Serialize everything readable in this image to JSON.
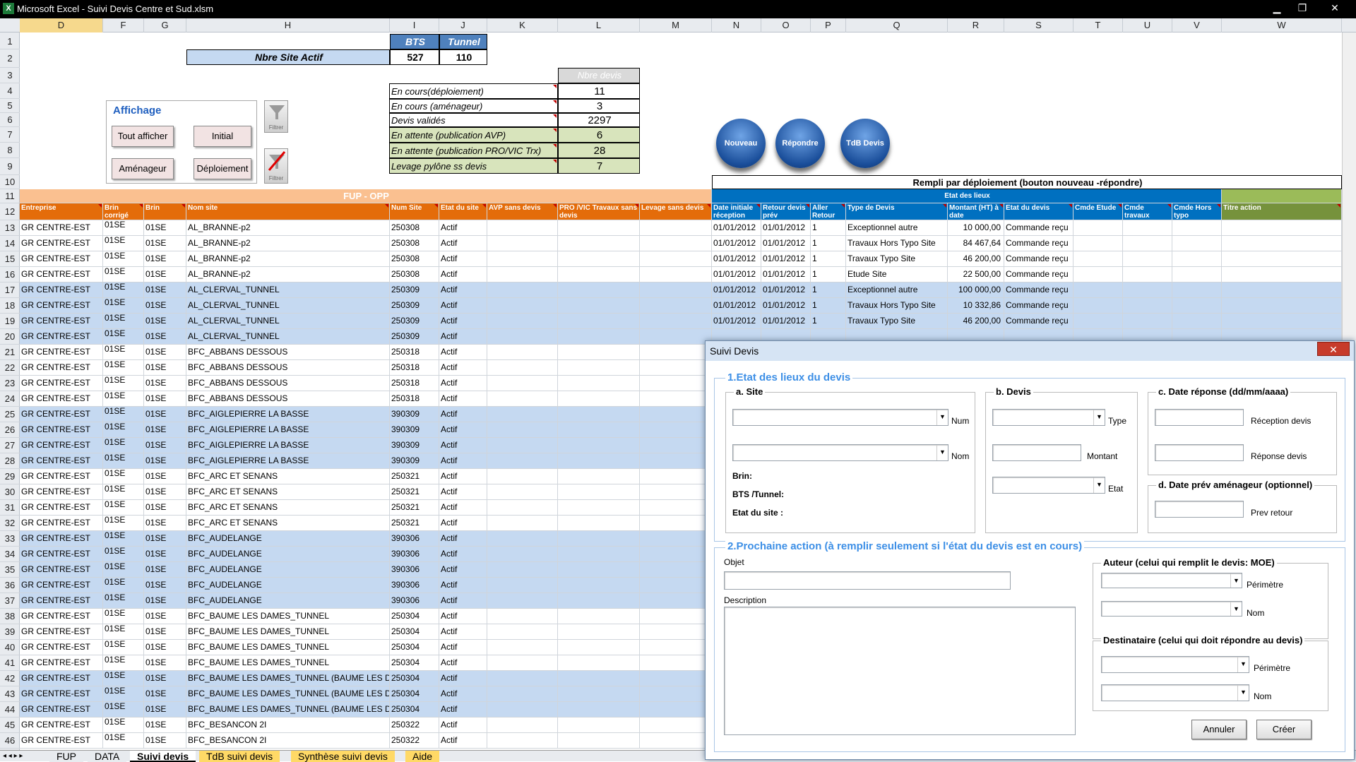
{
  "window": {
    "title": "Microsoft Excel - Suivi Devis Centre et Sud.xlsm",
    "app_icon": "X",
    "minimize": "▁",
    "restore": "❐",
    "close": "✕"
  },
  "columns": [
    "D",
    "F",
    "G",
    "H",
    "I",
    "J",
    "K",
    "L",
    "M",
    "N",
    "O",
    "P",
    "Q",
    "R",
    "S",
    "T",
    "U",
    "V",
    "W"
  ],
  "rows": [
    "1",
    "2",
    "3",
    "4",
    "5",
    "6",
    "7",
    "8",
    "9",
    "10",
    "11",
    "12",
    "13",
    "14",
    "15",
    "16",
    "17",
    "18",
    "19",
    "20",
    "21",
    "22",
    "23",
    "24",
    "25",
    "26",
    "27",
    "28",
    "29",
    "30",
    "31",
    "32",
    "33",
    "34",
    "35",
    "36",
    "37",
    "38",
    "39",
    "40",
    "41",
    "42",
    "43",
    "44",
    "45",
    "46"
  ],
  "top": {
    "bts": "BTS",
    "tunnel": "Tunnel",
    "nbre_site_actif": "Nbre Site Actif",
    "bts_val": "527",
    "tunnel_val": "110",
    "nbre_devis": "Nbre devis",
    "stats": [
      {
        "label": "En cours(déploiement)",
        "value": "11"
      },
      {
        "label": "En cours (aménageur)",
        "value": "3"
      },
      {
        "label": "Devis validés",
        "value": "2297"
      },
      {
        "label": "En attente (publication AVP)",
        "value": "6"
      },
      {
        "label": "En attente (publication PRO/VIC Trx)",
        "value": "28"
      },
      {
        "label": "Levage pylône ss devis",
        "value": "7"
      }
    ],
    "affichage": "Affichage",
    "tout_afficher": "Tout afficher",
    "initial": "Initial",
    "amenageur": "Aménageur",
    "deploiement": "Déploiement",
    "filtrer": "Filtrer",
    "filtrer2": "Filtrer",
    "nouveau": "Nouveau",
    "repondre": "Répondre",
    "tdb": "TdB Devis",
    "rempli": "Rempli par déploiement (bouton nouveau -répondre)",
    "fup": "FUP - OPP",
    "etat_lieux": "Etat des lieux"
  },
  "headers": [
    "Entreprise",
    "Brin corrigé",
    "Brin",
    "Nom site",
    "Num Site",
    "Etat du site",
    "AVP sans devis",
    "PRO /VIC Travaux sans devis",
    "Levage sans devis",
    "Date initiale réception",
    "Retour devis prév",
    "Aller Retour",
    "Type de Devis",
    "Montant (HT) à date",
    "Etat du devis",
    "Cmde Etude",
    "Cmde travaux",
    "Cmde Hors typo",
    "Titre action"
  ],
  "data_rows": [
    {
      "e": "GR CENTRE-EST",
      "bc": "01SE",
      "b": "01SE",
      "n": "AL_BRANNE-p2",
      "num": "250308",
      "et": "Actif",
      "d1": "01/01/2012",
      "d2": "01/01/2012",
      "ar": "1",
      "t": "Exceptionnel autre",
      "m": "10 000,00",
      "ed": "Commande reçu",
      "blue": false
    },
    {
      "e": "GR CENTRE-EST",
      "bc": "01SE",
      "b": "01SE",
      "n": "AL_BRANNE-p2",
      "num": "250308",
      "et": "Actif",
      "d1": "01/01/2012",
      "d2": "01/01/2012",
      "ar": "1",
      "t": "Travaux Hors Typo Site",
      "m": "84 467,64",
      "ed": "Commande reçu",
      "blue": false
    },
    {
      "e": "GR CENTRE-EST",
      "bc": "01SE",
      "b": "01SE",
      "n": "AL_BRANNE-p2",
      "num": "250308",
      "et": "Actif",
      "d1": "01/01/2012",
      "d2": "01/01/2012",
      "ar": "1",
      "t": "Travaux Typo Site",
      "m": "46 200,00",
      "ed": "Commande reçu",
      "blue": false
    },
    {
      "e": "GR CENTRE-EST",
      "bc": "01SE",
      "b": "01SE",
      "n": "AL_BRANNE-p2",
      "num": "250308",
      "et": "Actif",
      "d1": "01/01/2012",
      "d2": "01/01/2012",
      "ar": "1",
      "t": "Etude Site",
      "m": "22 500,00",
      "ed": "Commande reçu",
      "blue": false
    },
    {
      "e": "GR CENTRE-EST",
      "bc": "01SE",
      "b": "01SE",
      "n": "AL_CLERVAL_TUNNEL",
      "num": "250309",
      "et": "Actif",
      "d1": "01/01/2012",
      "d2": "01/01/2012",
      "ar": "1",
      "t": "Exceptionnel autre",
      "m": "100 000,00",
      "ed": "Commande reçu",
      "blue": true
    },
    {
      "e": "GR CENTRE-EST",
      "bc": "01SE",
      "b": "01SE",
      "n": "AL_CLERVAL_TUNNEL",
      "num": "250309",
      "et": "Actif",
      "d1": "01/01/2012",
      "d2": "01/01/2012",
      "ar": "1",
      "t": "Travaux Hors Typo Site",
      "m": "10 332,86",
      "ed": "Commande reçu",
      "blue": true
    },
    {
      "e": "GR CENTRE-EST",
      "bc": "01SE",
      "b": "01SE",
      "n": "AL_CLERVAL_TUNNEL",
      "num": "250309",
      "et": "Actif",
      "d1": "01/01/2012",
      "d2": "01/01/2012",
      "ar": "1",
      "t": "Travaux Typo Site",
      "m": "46 200,00",
      "ed": "Commande reçu",
      "blue": true
    },
    {
      "e": "GR CENTRE-EST",
      "bc": "01SE",
      "b": "01SE",
      "n": "AL_CLERVAL_TUNNEL",
      "num": "250309",
      "et": "Actif",
      "d1": "",
      "d2": "",
      "ar": "",
      "t": "",
      "m": "",
      "ed": "",
      "blue": true
    },
    {
      "e": "GR CENTRE-EST",
      "bc": "01SE",
      "b": "01SE",
      "n": "BFC_ABBANS DESSOUS",
      "num": "250318",
      "et": "Actif",
      "blue": false
    },
    {
      "e": "GR CENTRE-EST",
      "bc": "01SE",
      "b": "01SE",
      "n": "BFC_ABBANS DESSOUS",
      "num": "250318",
      "et": "Actif",
      "blue": false
    },
    {
      "e": "GR CENTRE-EST",
      "bc": "01SE",
      "b": "01SE",
      "n": "BFC_ABBANS DESSOUS",
      "num": "250318",
      "et": "Actif",
      "blue": false
    },
    {
      "e": "GR CENTRE-EST",
      "bc": "01SE",
      "b": "01SE",
      "n": "BFC_ABBANS DESSOUS",
      "num": "250318",
      "et": "Actif",
      "blue": false
    },
    {
      "e": "GR CENTRE-EST",
      "bc": "01SE",
      "b": "01SE",
      "n": "BFC_AIGLEPIERRE LA BASSE",
      "num": "390309",
      "et": "Actif",
      "blue": true
    },
    {
      "e": "GR CENTRE-EST",
      "bc": "01SE",
      "b": "01SE",
      "n": "BFC_AIGLEPIERRE LA BASSE",
      "num": "390309",
      "et": "Actif",
      "blue": true
    },
    {
      "e": "GR CENTRE-EST",
      "bc": "01SE",
      "b": "01SE",
      "n": "BFC_AIGLEPIERRE LA BASSE",
      "num": "390309",
      "et": "Actif",
      "blue": true
    },
    {
      "e": "GR CENTRE-EST",
      "bc": "01SE",
      "b": "01SE",
      "n": "BFC_AIGLEPIERRE LA BASSE",
      "num": "390309",
      "et": "Actif",
      "blue": true
    },
    {
      "e": "GR CENTRE-EST",
      "bc": "01SE",
      "b": "01SE",
      "n": "BFC_ARC ET SENANS",
      "num": "250321",
      "et": "Actif",
      "blue": false
    },
    {
      "e": "GR CENTRE-EST",
      "bc": "01SE",
      "b": "01SE",
      "n": "BFC_ARC ET SENANS",
      "num": "250321",
      "et": "Actif",
      "blue": false
    },
    {
      "e": "GR CENTRE-EST",
      "bc": "01SE",
      "b": "01SE",
      "n": "BFC_ARC ET SENANS",
      "num": "250321",
      "et": "Actif",
      "blue": false
    },
    {
      "e": "GR CENTRE-EST",
      "bc": "01SE",
      "b": "01SE",
      "n": "BFC_ARC ET SENANS",
      "num": "250321",
      "et": "Actif",
      "blue": false
    },
    {
      "e": "GR CENTRE-EST",
      "bc": "01SE",
      "b": "01SE",
      "n": "BFC_AUDELANGE",
      "num": "390306",
      "et": "Actif",
      "blue": true
    },
    {
      "e": "GR CENTRE-EST",
      "bc": "01SE",
      "b": "01SE",
      "n": "BFC_AUDELANGE",
      "num": "390306",
      "et": "Actif",
      "blue": true
    },
    {
      "e": "GR CENTRE-EST",
      "bc": "01SE",
      "b": "01SE",
      "n": "BFC_AUDELANGE",
      "num": "390306",
      "et": "Actif",
      "blue": true
    },
    {
      "e": "GR CENTRE-EST",
      "bc": "01SE",
      "b": "01SE",
      "n": "BFC_AUDELANGE",
      "num": "390306",
      "et": "Actif",
      "blue": true
    },
    {
      "e": "GR CENTRE-EST",
      "bc": "01SE",
      "b": "01SE",
      "n": "BFC_AUDELANGE",
      "num": "390306",
      "et": "Actif",
      "blue": true
    },
    {
      "e": "GR CENTRE-EST",
      "bc": "01SE",
      "b": "01SE",
      "n": "BFC_BAUME LES DAMES_TUNNEL",
      "num": "250304",
      "et": "Actif",
      "blue": false
    },
    {
      "e": "GR CENTRE-EST",
      "bc": "01SE",
      "b": "01SE",
      "n": "BFC_BAUME LES DAMES_TUNNEL",
      "num": "250304",
      "et": "Actif",
      "blue": false
    },
    {
      "e": "GR CENTRE-EST",
      "bc": "01SE",
      "b": "01SE",
      "n": "BFC_BAUME LES DAMES_TUNNEL",
      "num": "250304",
      "et": "Actif",
      "blue": false
    },
    {
      "e": "GR CENTRE-EST",
      "bc": "01SE",
      "b": "01SE",
      "n": "BFC_BAUME LES DAMES_TUNNEL",
      "num": "250304",
      "et": "Actif",
      "blue": false
    },
    {
      "e": "GR CENTRE-EST",
      "bc": "01SE",
      "b": "01SE",
      "n": "BFC_BAUME LES DAMES_TUNNEL (BAUME LES DA",
      "num": "250304",
      "et": "Actif",
      "blue": true
    },
    {
      "e": "GR CENTRE-EST",
      "bc": "01SE",
      "b": "01SE",
      "n": "BFC_BAUME LES DAMES_TUNNEL (BAUME LES DA",
      "num": "250304",
      "et": "Actif",
      "blue": true
    },
    {
      "e": "GR CENTRE-EST",
      "bc": "01SE",
      "b": "01SE",
      "n": "BFC_BAUME LES DAMES_TUNNEL (BAUME LES DA",
      "num": "250304",
      "et": "Actif",
      "blue": true
    },
    {
      "e": "GR CENTRE-EST",
      "bc": "01SE",
      "b": "01SE",
      "n": "BFC_BESANCON 2I",
      "num": "250322",
      "et": "Actif",
      "blue": false
    },
    {
      "e": "GR CENTRE-EST",
      "bc": "01SE",
      "b": "01SE",
      "n": "BFC_BESANCON 2I",
      "num": "250322",
      "et": "Actif",
      "blue": false
    }
  ],
  "tabs": {
    "nav": "◂ ◂ ▸ ▸",
    "items": [
      "FUP",
      "DATA",
      "Suivi devis",
      "TdB suivi devis",
      "Synthèse suivi devis",
      "Aide"
    ],
    "active": "Suivi devis"
  },
  "dialog": {
    "title": "Suivi Devis",
    "close": "✕",
    "section1": "1.Etat des lieux du devis",
    "site": "a. Site",
    "num": "Num",
    "nom": "Nom",
    "brin": "Brin:",
    "bts_tunnel": "BTS /Tunnel:",
    "etat_site": "Etat du site :",
    "devis": "b. Devis",
    "type": "Type",
    "montant": "Montant",
    "etat": "Etat",
    "date_rep": "c. Date réponse (dd/mm/aaaa)",
    "reception": "Réception devis",
    "reponse": "Réponse devis",
    "date_prev": "d. Date prév aménageur (optionnel)",
    "prev_retour": "Prev retour",
    "section2": "2.Prochaine action (à remplir seulement si l'état du devis est en cours)",
    "objet": "Objet",
    "description": "Description",
    "auteur": "Auteur (celui qui remplit le devis: MOE)",
    "perimetre": "Périmètre",
    "nom2": "Nom",
    "destinataire": "Destinataire (celui qui doit répondre au devis)",
    "perimetre2": "Périmètre",
    "nom3": "Nom",
    "annuler": "Annuler",
    "creer": "Créer",
    "arrow": "▼"
  }
}
